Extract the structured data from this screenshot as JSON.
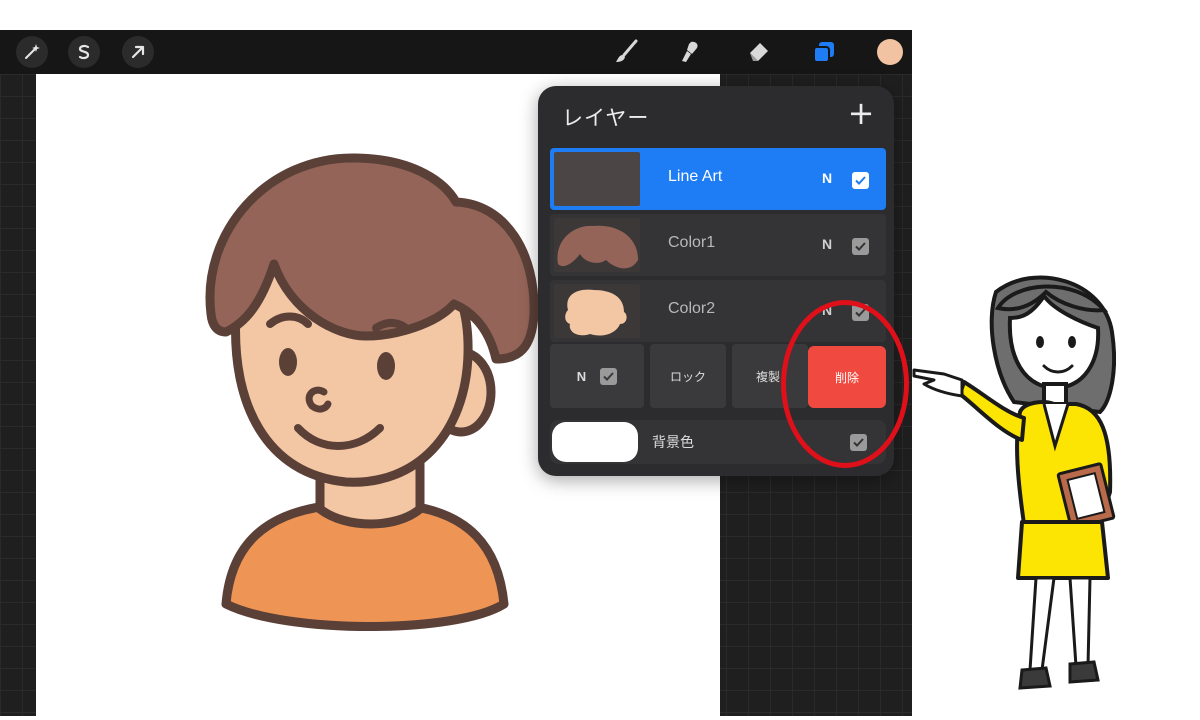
{
  "toolbar": {
    "left_tools": [
      "magic-wand-icon",
      "selection-s-icon",
      "transform-arrow-icon"
    ],
    "right_tools": [
      "brush-icon",
      "smudge-icon",
      "eraser-icon",
      "layers-icon",
      "color-swatch"
    ],
    "active_color": "#f1c3a3",
    "layers_accent": "#1e7cf4"
  },
  "layers_panel": {
    "title": "レイヤー",
    "add_label": "+",
    "layers": [
      {
        "name": "Line Art",
        "blend": "N",
        "visible": true,
        "selected": true
      },
      {
        "name": "Color1",
        "blend": "N",
        "visible": true,
        "selected": false
      },
      {
        "name": "Color2",
        "blend": "N",
        "visible": true,
        "selected": false
      }
    ],
    "actions": {
      "blend": "N",
      "lock": "ロック",
      "duplicate": "複製",
      "delete": "削除"
    },
    "background": {
      "label": "背景色",
      "visible": true
    }
  },
  "colors": {
    "hair": "#946458",
    "skin": "#f3c6a4",
    "shirt": "#ee9556",
    "outline": "#5b4038",
    "delete": "#f04a40",
    "highlight_ring": "#e0101a",
    "presenter_suit": "#fce403"
  }
}
